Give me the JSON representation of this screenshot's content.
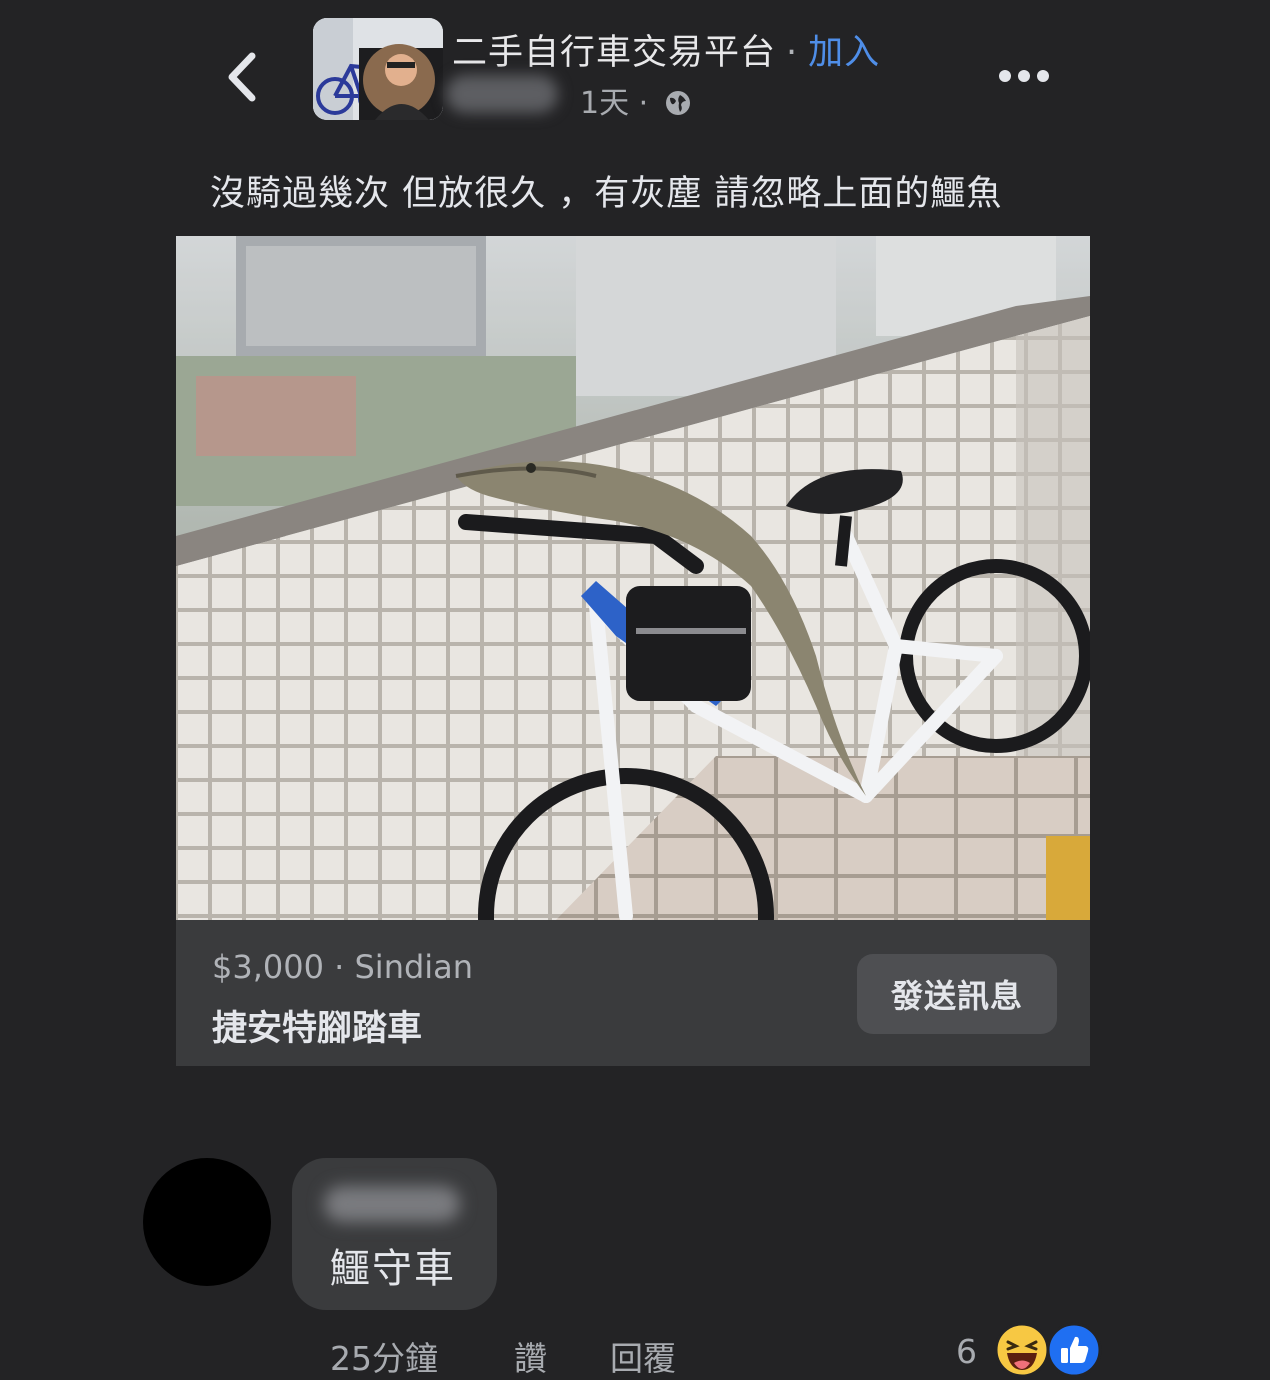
{
  "header": {
    "group_name": "二手自行車交易平台",
    "separator": "·",
    "join_label": "加入",
    "time_ago": "1天",
    "meta_separator": "·",
    "privacy_icon": "globe-icon",
    "back_icon": "chevron-left-icon",
    "more_icon": "more-dots-icon"
  },
  "post": {
    "text": "沒騎過幾次 但放很久 ，有灰塵 請忽略上面的鱷魚"
  },
  "listing": {
    "price": "$3,000",
    "separator": "·",
    "location": "Sindian",
    "title": "捷安特腳踏車",
    "send_button": "發送訊息"
  },
  "comment": {
    "text": "鱷守車",
    "time": "25分鐘",
    "like_label": "讚",
    "reply_label": "回覆",
    "reaction_count": "6",
    "reactions": [
      "haha-icon",
      "like-icon"
    ]
  },
  "colors": {
    "background": "#232325",
    "card": "#3a3b3d",
    "accent_link": "#4f8ee8",
    "like_blue": "#1f6ff2"
  }
}
